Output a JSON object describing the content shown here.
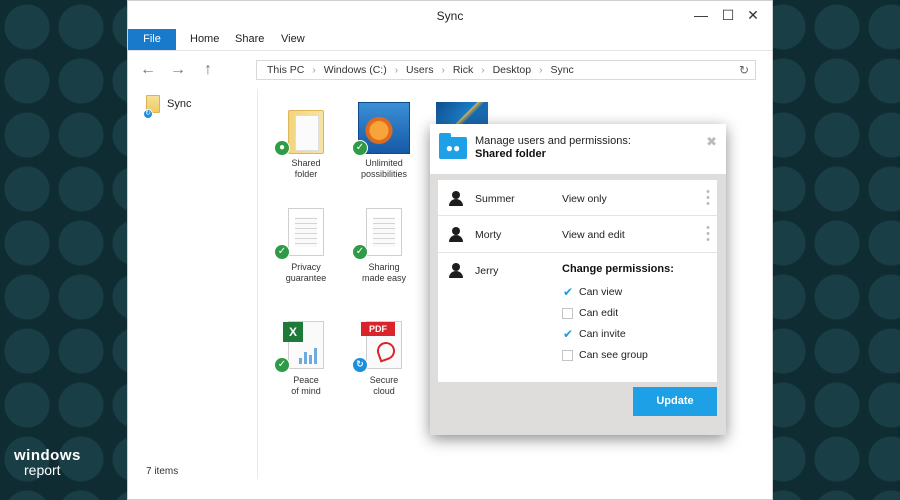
{
  "window": {
    "title": "Sync",
    "controls": {
      "minimize": "—",
      "maximize": "☐",
      "close": "✕"
    }
  },
  "ribbon": {
    "tabs": [
      "File",
      "Home",
      "Share",
      "View"
    ]
  },
  "address": {
    "crumbs": [
      "This PC",
      "Windows (C:)",
      "Users",
      "Rick",
      "Desktop",
      "Sync"
    ],
    "separator": "›"
  },
  "navpane": {
    "items": [
      {
        "label": "Sync",
        "icon": "sync-folder-icon"
      }
    ]
  },
  "files": [
    {
      "caption": "Shared\nfolder",
      "icon": "folder-icon",
      "badge": "shared"
    },
    {
      "caption": "Unlimited\npossibilities",
      "icon": "goldfish-photo-icon",
      "badge": "synced"
    },
    {
      "caption": "Privacy\nguarantee",
      "icon": "document-icon",
      "badge": "synced"
    },
    {
      "caption": "Sharing\nmade easy",
      "icon": "document-icon",
      "badge": "synced"
    },
    {
      "caption": "Peace\nof mind",
      "icon": "excel-icon",
      "badge": "synced"
    },
    {
      "caption": "Secure\ncloud",
      "icon": "pdf-icon",
      "badge": "syncing",
      "tag": "PDF"
    }
  ],
  "status": {
    "items_count": "7 items"
  },
  "dialog": {
    "title": "Manage users and permissions:",
    "subtitle": "Shared folder",
    "users": [
      {
        "name": "Summer",
        "permission": "View only"
      },
      {
        "name": "Morty",
        "permission": "View and edit"
      },
      {
        "name": "Jerry",
        "permission": ""
      }
    ],
    "change_title": "Change permissions:",
    "checkboxes": [
      {
        "label": "Can view",
        "checked": true
      },
      {
        "label": "Can edit",
        "checked": false
      },
      {
        "label": "Can invite",
        "checked": true
      },
      {
        "label": "Can see group",
        "checked": false
      }
    ],
    "update_label": "Update"
  },
  "watermark": {
    "line1": "windows",
    "line2": "report"
  },
  "colors": {
    "accent": "#1ea0e6",
    "file_tab": "#1979ca",
    "badge_green": "#2f9b47",
    "background": "#0f2c33"
  }
}
